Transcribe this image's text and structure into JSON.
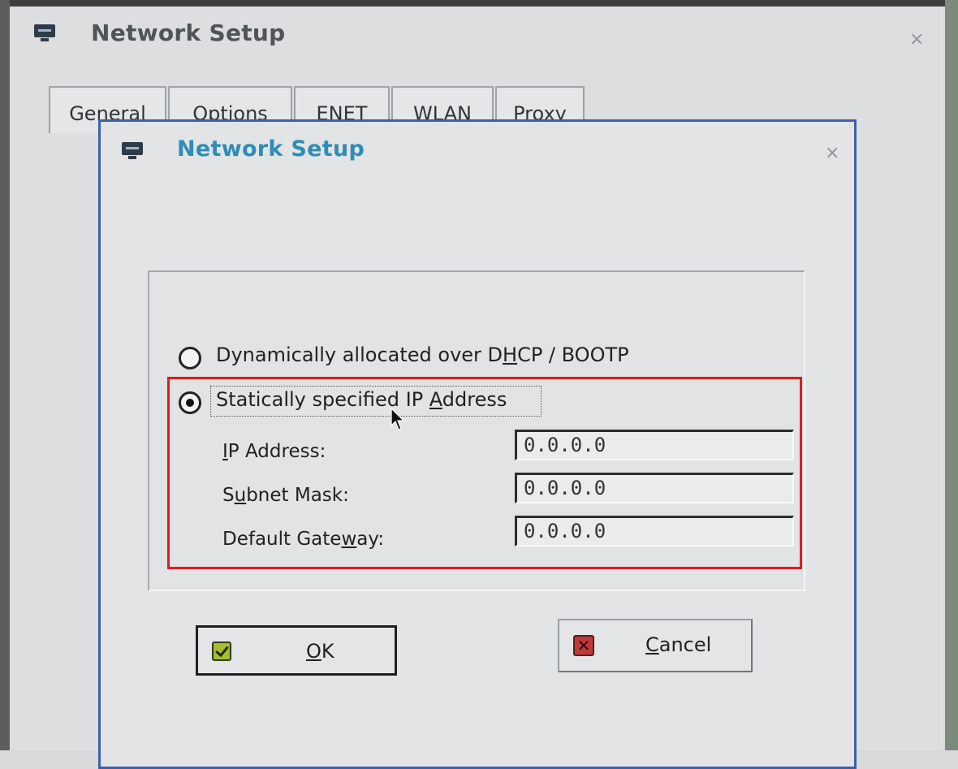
{
  "back_window": {
    "title": "Network Setup",
    "close": "×",
    "tabs": [
      {
        "label": "General"
      },
      {
        "label": "Options"
      },
      {
        "label": "ENET"
      },
      {
        "label": "WLAN"
      },
      {
        "label": "Proxy"
      }
    ]
  },
  "dialog": {
    "title": "Network Setup",
    "close": "×",
    "options": {
      "dhcp": {
        "pre": "Dynamically allocated over D",
        "key": "H",
        "post": "CP / BOOTP",
        "selected": false
      },
      "static": {
        "pre": "Statically specified IP ",
        "key": "A",
        "post": "ddress",
        "selected": true
      }
    },
    "fields": [
      {
        "label_pre": "",
        "label_key": "I",
        "label_post": "P Address:",
        "value": "0.0.0.0"
      },
      {
        "label_pre": "S",
        "label_key": "u",
        "label_post": "bnet Mask:",
        "value": "0.0.0.0"
      },
      {
        "label_pre": "Default Gate",
        "label_key": "w",
        "label_post": "ay:",
        "value": "0.0.0.0"
      }
    ],
    "buttons": {
      "ok": {
        "key": "O",
        "rest": "K"
      },
      "cancel": {
        "key": "C",
        "rest": "ancel"
      }
    }
  },
  "colors": {
    "highlight": "#e11b1b",
    "dialog_title": "#2f8db5",
    "dialog_border": "#3e5fb0"
  }
}
